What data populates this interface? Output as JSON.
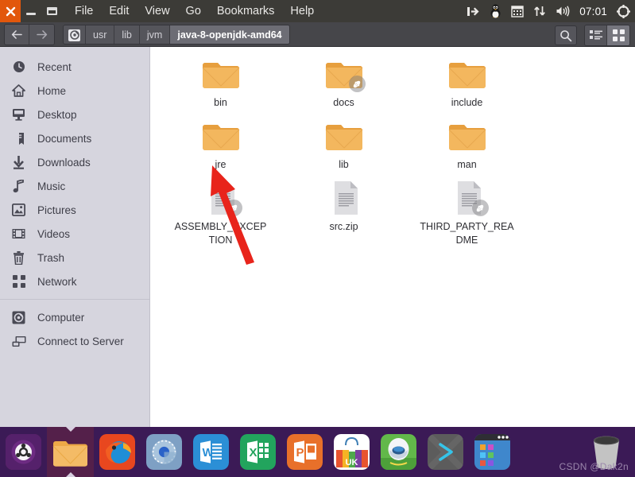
{
  "window": {
    "controls": {
      "close": "close-button",
      "minimize": "minimize-button",
      "maximize": "maximize-button"
    },
    "menus": [
      "File",
      "Edit",
      "View",
      "Go",
      "Bookmarks",
      "Help"
    ]
  },
  "tray": {
    "icons": [
      "input-indicator-icon",
      "tux-penguin-icon",
      "calendar-icon",
      "network-transfer-icon",
      "volume-icon",
      "settings-gear-icon"
    ],
    "clock": "07:01"
  },
  "toolbar": {
    "back": "back-arrow-icon",
    "forward": "forward-arrow-icon",
    "breadcrumbs": [
      {
        "label": "",
        "icon": "computer-drive-icon",
        "active": false
      },
      {
        "label": "usr",
        "icon": "",
        "active": false
      },
      {
        "label": "lib",
        "icon": "",
        "active": false
      },
      {
        "label": "jvm",
        "icon": "",
        "active": false
      },
      {
        "label": "java-8-openjdk-amd64",
        "icon": "",
        "active": true
      }
    ],
    "search": "search-icon",
    "list_view": "list-view-icon",
    "grid_view": "grid-view-icon",
    "active_view": "grid"
  },
  "sidebar": {
    "items": [
      {
        "label": "Recent",
        "icon": "clock-icon"
      },
      {
        "label": "Home",
        "icon": "home-icon"
      },
      {
        "label": "Desktop",
        "icon": "desktop-icon"
      },
      {
        "label": "Documents",
        "icon": "documents-icon"
      },
      {
        "label": "Downloads",
        "icon": "download-arrow-icon"
      },
      {
        "label": "Music",
        "icon": "music-note-icon"
      },
      {
        "label": "Pictures",
        "icon": "pictures-icon"
      },
      {
        "label": "Videos",
        "icon": "videos-film-icon"
      },
      {
        "label": "Trash",
        "icon": "trash-icon"
      },
      {
        "label": "Network",
        "icon": "network-icon"
      }
    ],
    "devices": [
      {
        "label": "Computer",
        "icon": "computer-drive-icon"
      },
      {
        "label": "Connect to Server",
        "icon": "connect-server-icon"
      }
    ]
  },
  "files": [
    {
      "name": "bin",
      "type": "folder",
      "symlink": false
    },
    {
      "name": "docs",
      "type": "folder",
      "symlink": true
    },
    {
      "name": "include",
      "type": "folder",
      "symlink": false
    },
    {
      "name": "jre",
      "type": "folder",
      "symlink": false
    },
    {
      "name": "lib",
      "type": "folder",
      "symlink": false
    },
    {
      "name": "man",
      "type": "folder",
      "symlink": false
    },
    {
      "name": "ASSEMBLY_EXCEPTION",
      "type": "document",
      "symlink": true
    },
    {
      "name": "src.zip",
      "type": "document",
      "symlink": false
    },
    {
      "name": "THIRD_PARTY_README",
      "type": "document",
      "symlink": true
    }
  ],
  "annotation": {
    "type": "red-arrow",
    "points_to": "jre",
    "color": "#e8241b"
  },
  "dock": {
    "items": [
      {
        "name": "ubuntu-logo-icon",
        "active": false
      },
      {
        "name": "files-manager-icon",
        "active": true
      },
      {
        "name": "firefox-icon",
        "active": false
      },
      {
        "name": "chromium-icon",
        "active": false
      },
      {
        "name": "word-icon",
        "label": "W",
        "active": false
      },
      {
        "name": "excel-icon",
        "label": "X",
        "active": false
      },
      {
        "name": "powerpoint-icon",
        "label": "P",
        "active": false
      },
      {
        "name": "ubuntu-software-icon",
        "label": "UK",
        "active": false
      },
      {
        "name": "software-center-robot-icon",
        "active": false
      },
      {
        "name": "terminal-icon",
        "active": false
      },
      {
        "name": "show-applications-icon",
        "active": false
      }
    ],
    "trash": "trash-dock-icon",
    "watermark": "CSDN @Dak2n"
  },
  "colors": {
    "titlebar": "#3c3b37",
    "close_button": "#e2570c",
    "toolbar": "#46464a",
    "sidebar": "#d6d5de",
    "dock": "#3b1a56",
    "folder": "#f0ae52",
    "arrow": "#e8241b"
  }
}
